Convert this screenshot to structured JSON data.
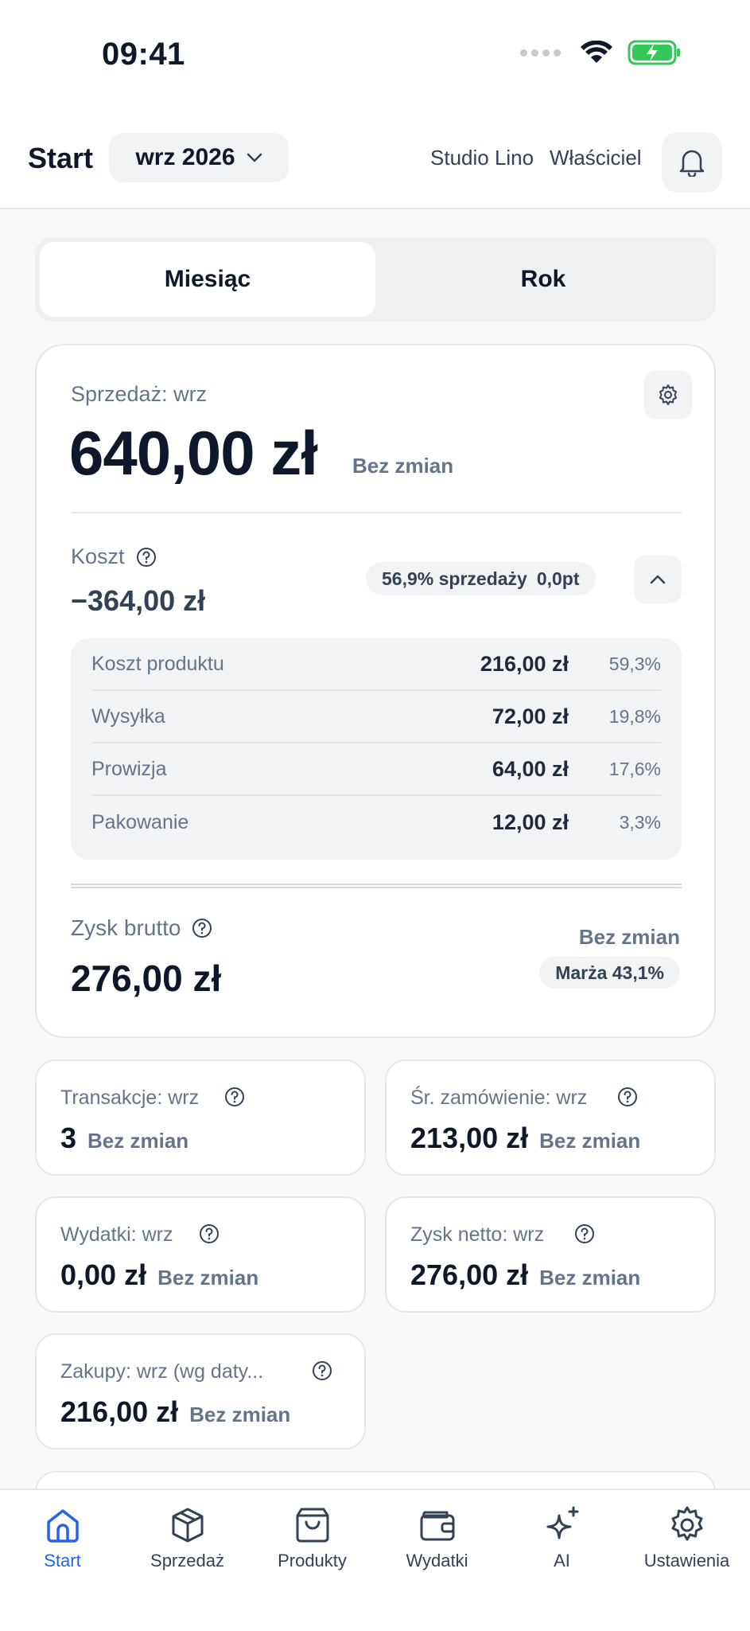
{
  "status_bar": {
    "time": "09:41"
  },
  "header": {
    "title": "Start",
    "period": "wrz 2026",
    "studio": "Studio Lino",
    "role": "Właściciel"
  },
  "segment": {
    "tabs": [
      "Miesiąc",
      "Rok"
    ],
    "active": "Miesiąc"
  },
  "sales": {
    "label": "Sprzedaż: wrz",
    "value": "640,00 zł",
    "change": "Bez zmian"
  },
  "cost": {
    "label": "Koszt",
    "value": "−364,00 zł",
    "share": "56,9% sprzedaży",
    "delta": "0,0pt",
    "rows": [
      {
        "name": "Koszt produktu",
        "amount": "216,00 zł",
        "pct": "59,3%"
      },
      {
        "name": "Wysyłka",
        "amount": "72,00 zł",
        "pct": "19,8%"
      },
      {
        "name": "Prowizja",
        "amount": "64,00 zł",
        "pct": "17,6%"
      },
      {
        "name": "Pakowanie",
        "amount": "12,00 zł",
        "pct": "3,3%"
      }
    ]
  },
  "gross_profit": {
    "label": "Zysk brutto",
    "value": "276,00 zł",
    "change": "Bez zmian",
    "margin": "Marża 43,1%"
  },
  "stats": [
    {
      "label": "Transakcje: wrz",
      "value": "3",
      "change": "Bez zmian"
    },
    {
      "label": "Śr. zamówienie: wrz",
      "value": "213,00 zł",
      "change": "Bez zmian"
    },
    {
      "label": "Wydatki: wrz",
      "value": "0,00 zł",
      "change": "Bez zmian"
    },
    {
      "label": "Zysk netto: wrz",
      "value": "276,00 zł",
      "change": "Bez zmian"
    },
    {
      "label": "Zakupy: wrz (wg daty...",
      "value": "216,00 zł",
      "change": "Bez zmian"
    }
  ],
  "tab_bar": {
    "items": [
      "Start",
      "Sprzedaż",
      "Produkty",
      "Wydatki",
      "AI",
      "Ustawienia"
    ],
    "active": "Start"
  },
  "colors": {
    "accent": "#2563eb",
    "text_primary": "#0f172a",
    "text_muted": "#64748b",
    "battery": "#34c759"
  }
}
